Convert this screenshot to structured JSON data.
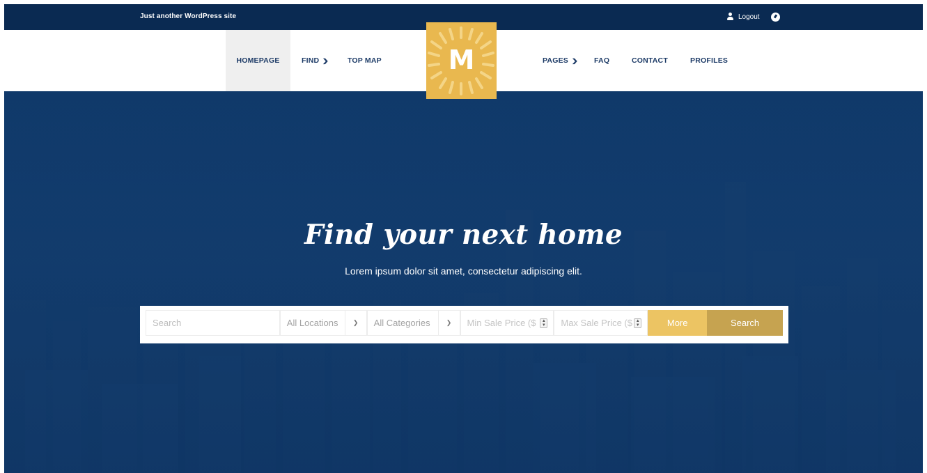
{
  "topbar": {
    "tagline": "Just another WordPress site",
    "logout_label": "Logout",
    "icons": [
      "user-icon",
      "dashboard-icon"
    ]
  },
  "nav": {
    "homepage": "HOMEPAGE",
    "find": "FIND",
    "top_map": "TOP MAP",
    "pages": "PAGES",
    "faq": "FAQ",
    "contact": "CONTACT",
    "profiles": "PROFILES",
    "dropdown_icon": "chevron-down-icon",
    "active": "HOMEPAGE"
  },
  "logo": {
    "letter": "M"
  },
  "hero": {
    "title": "Find your next home",
    "subtitle": "Lorem ipsum dolor sit amet, consectetur adipiscing elit."
  },
  "search": {
    "search_placeholder": "Search",
    "location_value": "All Locations",
    "category_value": "All Categories",
    "min_price_placeholder": "Min Sale Price  ($",
    "max_price_placeholder": "Max Sale Price  ($",
    "more_label": "More",
    "search_label": "Search"
  },
  "colors": {
    "topbar": "#0a2a52",
    "hero": "#123b6a",
    "accent_gold": "#ecc463",
    "accent_dark_gold": "#c6a350",
    "logo_bg": "#e9b84f"
  }
}
